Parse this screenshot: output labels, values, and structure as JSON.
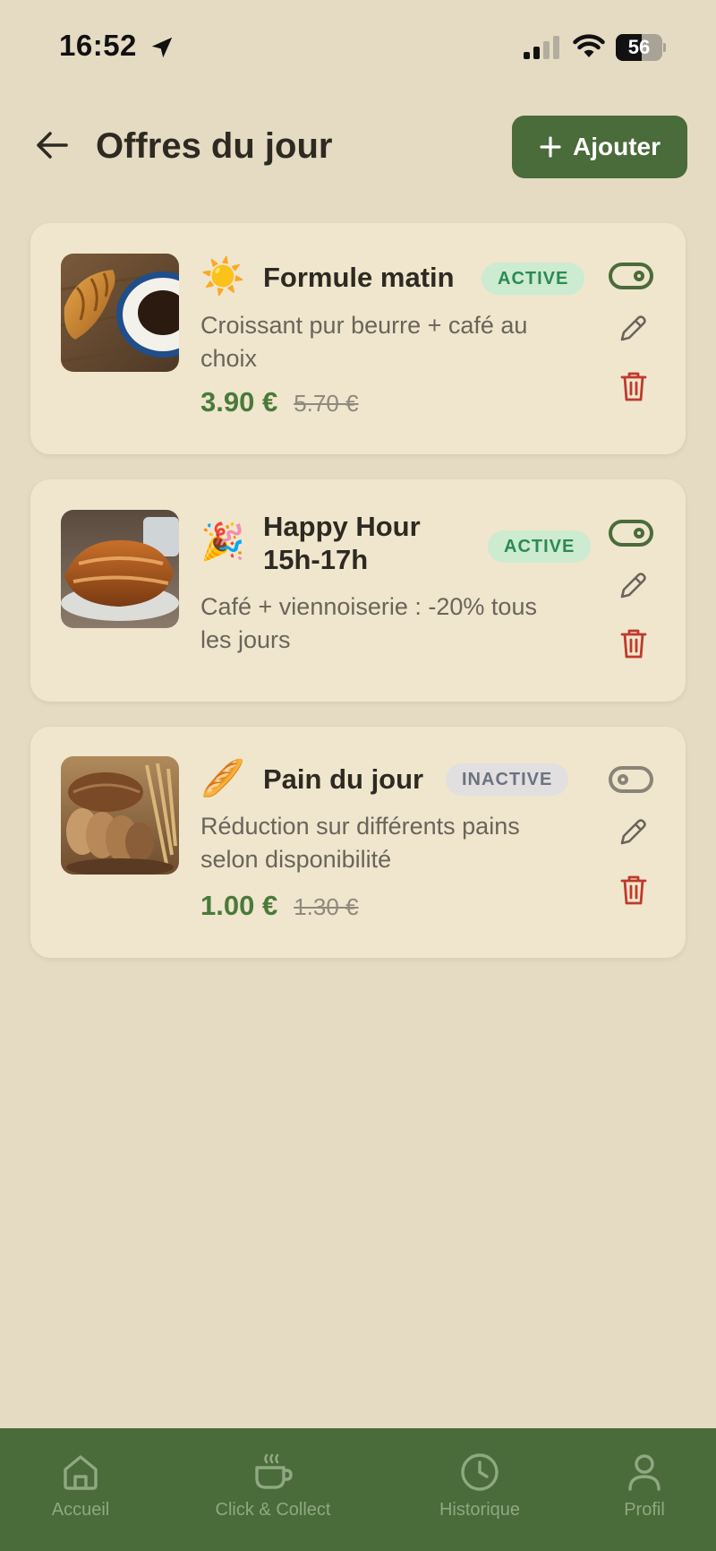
{
  "status_bar": {
    "time": "16:52",
    "battery": "56",
    "battery_level": 0.56
  },
  "header": {
    "title": "Offres du jour",
    "add_label": "Ajouter"
  },
  "offers": [
    {
      "emoji": "☀️",
      "title_lines": [
        "Formule matin"
      ],
      "status": "ACTIVE",
      "enabled": true,
      "description_lines": [
        "Croissant pur beurre + café au",
        "choix"
      ],
      "price_new": "3.90 €",
      "price_old": "5.70 €",
      "image": "croissant-coffee"
    },
    {
      "emoji": "🎉",
      "title_lines": [
        "Happy Hour",
        "15h-17h"
      ],
      "status": "ACTIVE",
      "enabled": true,
      "description_lines": [
        "Café + viennoiserie : -20% tous",
        "les jours"
      ],
      "image": "pain-au-chocolat"
    },
    {
      "emoji": "🥖",
      "title_lines": [
        "Pain du jour"
      ],
      "status": "INACTIVE",
      "enabled": false,
      "description_lines": [
        "Réduction sur différents pains",
        "selon disponibilité"
      ],
      "price_new": "1.00 €",
      "price_old": "1.30 €",
      "image": "bread-wheat"
    }
  ],
  "bottom_nav": [
    {
      "label": "Accueil",
      "icon": "home-icon"
    },
    {
      "label": "Click & Collect",
      "icon": "coffee-cup-icon"
    },
    {
      "label": "Historique",
      "icon": "clock-icon"
    },
    {
      "label": "Profil",
      "icon": "user-icon"
    }
  ],
  "colors": {
    "background": "#e5dbc2",
    "card": "#efe6cd",
    "primary": "#4a6b3a",
    "price": "#4a7a3a",
    "delete": "#c0392b",
    "badge_active_bg": "#cdebd0",
    "badge_active_text": "#2b8a55",
    "badge_inactive_bg": "#e1dfe0",
    "badge_inactive_text": "#6d7280"
  }
}
